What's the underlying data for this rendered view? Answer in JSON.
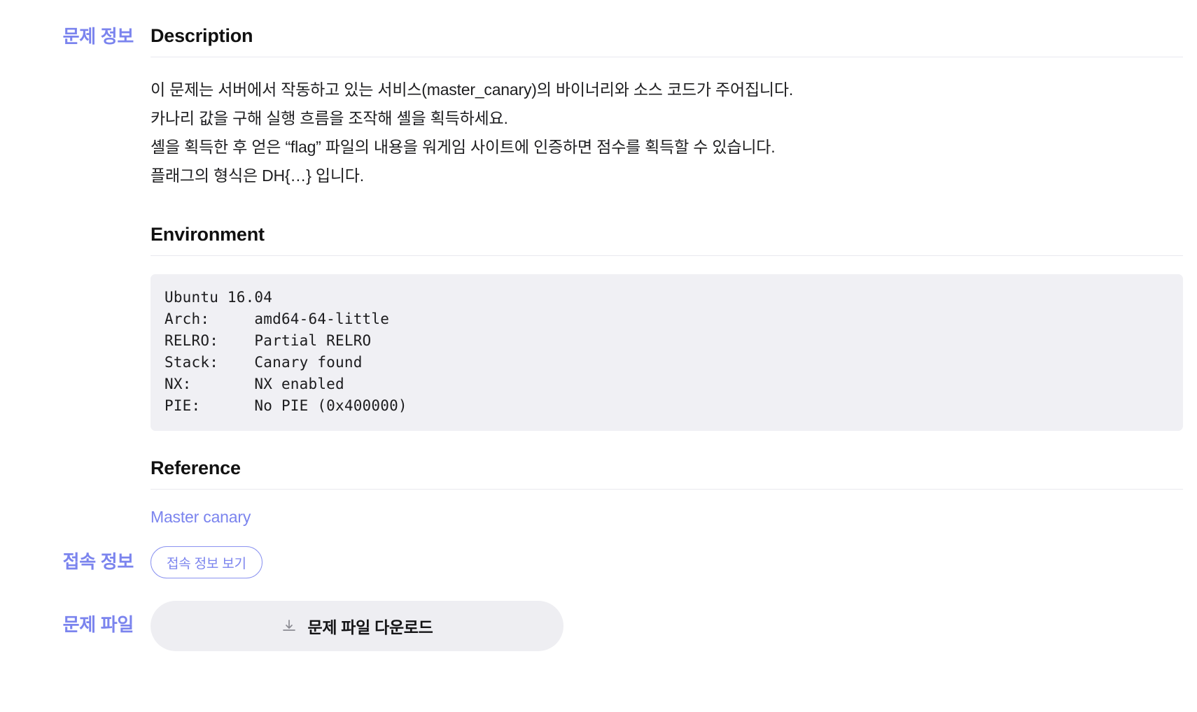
{
  "sidebar_labels": {
    "problem_info": "문제 정보",
    "access_info": "접속 정보",
    "problem_file": "문제 파일"
  },
  "description": {
    "heading": "Description",
    "lines": [
      "이 문제는 서버에서 작동하고 있는 서비스(master_canary)의 바이너리와 소스 코드가 주어집니다.",
      "카나리 값을 구해 실행 흐름을 조작해 셸을 획득하세요.",
      "셸을 획득한 후 얻은 “flag” 파일의 내용을 워게임 사이트에 인증하면 점수를 획득할 수 있습니다.",
      "플래그의 형식은 DH{…} 입니다."
    ]
  },
  "environment": {
    "heading": "Environment",
    "lines": [
      "Ubuntu 16.04",
      "Arch:     amd64-64-little",
      "RELRO:    Partial RELRO",
      "Stack:    Canary found",
      "NX:       NX enabled",
      "PIE:      No PIE (0x400000)"
    ]
  },
  "reference": {
    "heading": "Reference",
    "link_label": "Master canary"
  },
  "access_info": {
    "button_label": "접속 정보 보기"
  },
  "problem_file": {
    "button_label": "문제 파일 다운로드",
    "icon": "download-icon"
  },
  "colors": {
    "accent": "#7b84ee",
    "code_background": "#f0f0f4",
    "download_background": "#eeeef2",
    "rule": "#e9e9ef",
    "text": "#1d1d1f"
  }
}
